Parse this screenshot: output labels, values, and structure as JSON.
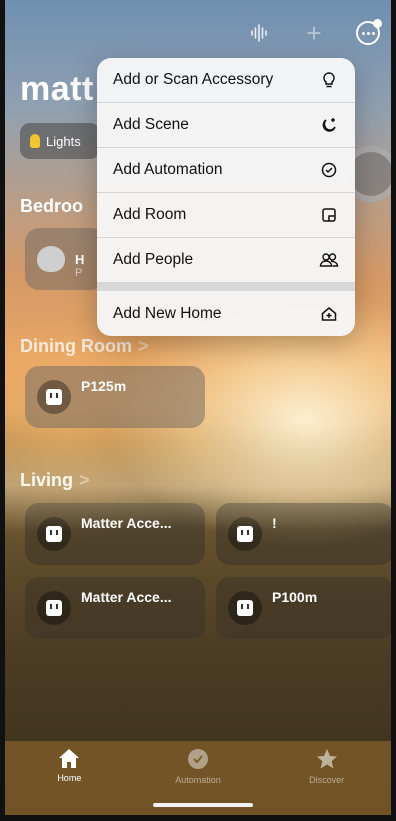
{
  "home": {
    "title": "matt"
  },
  "chips": {
    "lights": "Lights"
  },
  "sections": {
    "bedroom": {
      "title": "Bedroo",
      "tile": {
        "name": "H",
        "sub": "P"
      }
    },
    "dining": {
      "title": "Dining Room",
      "chev": ">",
      "tiles": [
        {
          "name": "P125m"
        }
      ]
    },
    "living": {
      "title": "Living",
      "chev": ">",
      "tiles": [
        {
          "name": "Matter Acce..."
        },
        {
          "name": "!"
        },
        {
          "name": "Matter Acce..."
        },
        {
          "name": "P100m"
        }
      ]
    }
  },
  "menu": {
    "items": [
      {
        "label": "Add or Scan Accessory",
        "icon": "lightbulb-icon"
      },
      {
        "label": "Add Scene",
        "icon": "moon-plus-icon"
      },
      {
        "label": "Add Automation",
        "icon": "clock-check-icon"
      },
      {
        "label": "Add Room",
        "icon": "room-icon"
      },
      {
        "label": "Add People",
        "icon": "people-icon"
      }
    ],
    "new_home": {
      "label": "Add New Home",
      "icon": "house-plus-icon"
    }
  },
  "tabs": [
    {
      "label": "Home",
      "icon": "house-icon",
      "active": true
    },
    {
      "label": "Automation",
      "icon": "clock-icon",
      "active": false
    },
    {
      "label": "Discover",
      "icon": "star-icon",
      "active": false
    }
  ]
}
